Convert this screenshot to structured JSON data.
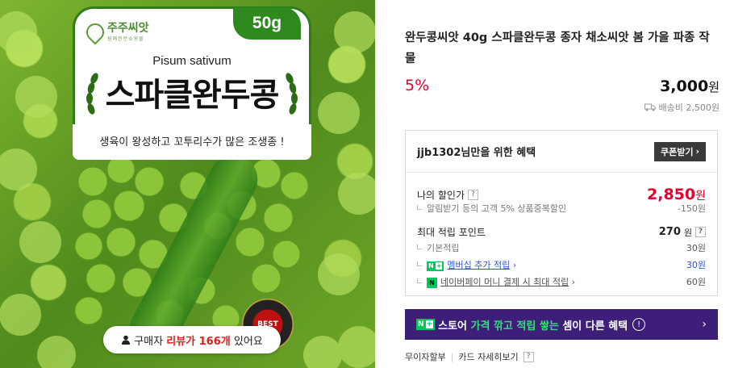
{
  "image": {
    "brand_name": "주주씨앗",
    "brand_subtitle": "원예전문쇼핑몰",
    "weight": "50g",
    "latin_name": "Pisum sativum",
    "pack_title": "스파클완두콩",
    "slogan": "생육이 왕성하고 꼬투리수가 많은 조생종 !",
    "best_badge": "BEST",
    "review": {
      "prefix": "구매자",
      "highlight": "리뷰가 166개",
      "suffix": "있어요"
    }
  },
  "product": {
    "title": "완두콩씨앗 40g 스파클완두콩 종자 채소씨앗 봄 가을 파종 작물",
    "discount_rate": "5%",
    "price": "3,000",
    "currency": "원",
    "shipping": "배송비 2,500원"
  },
  "benefit": {
    "title": "jjb1302님만을 위한 혜택",
    "coupon_button": "쿠폰받기",
    "my_discount_label": "나의 할인가",
    "my_discount_price": "2,850",
    "discount_detail_label": "알림받기 등의 고객 5% 상품중복할인",
    "discount_detail_value": "-150원",
    "max_point_label": "최대 적립 포인트",
    "max_point_value": "270",
    "basic_point_label": "기본적립",
    "basic_point_value": "30원",
    "membership_label": "멤버십 추가 적립",
    "membership_value": "30원",
    "npay_label": "네이버페이 머니 결제 시 최대 적립",
    "npay_value": "60원"
  },
  "store_banner": {
    "part1": "스토어",
    "part2": "가격 깎고 적립 쌓는",
    "part3": "셈이 다른 혜택"
  },
  "footer": {
    "installment": "무이자할부",
    "card_info": "카드 자세히보기"
  }
}
